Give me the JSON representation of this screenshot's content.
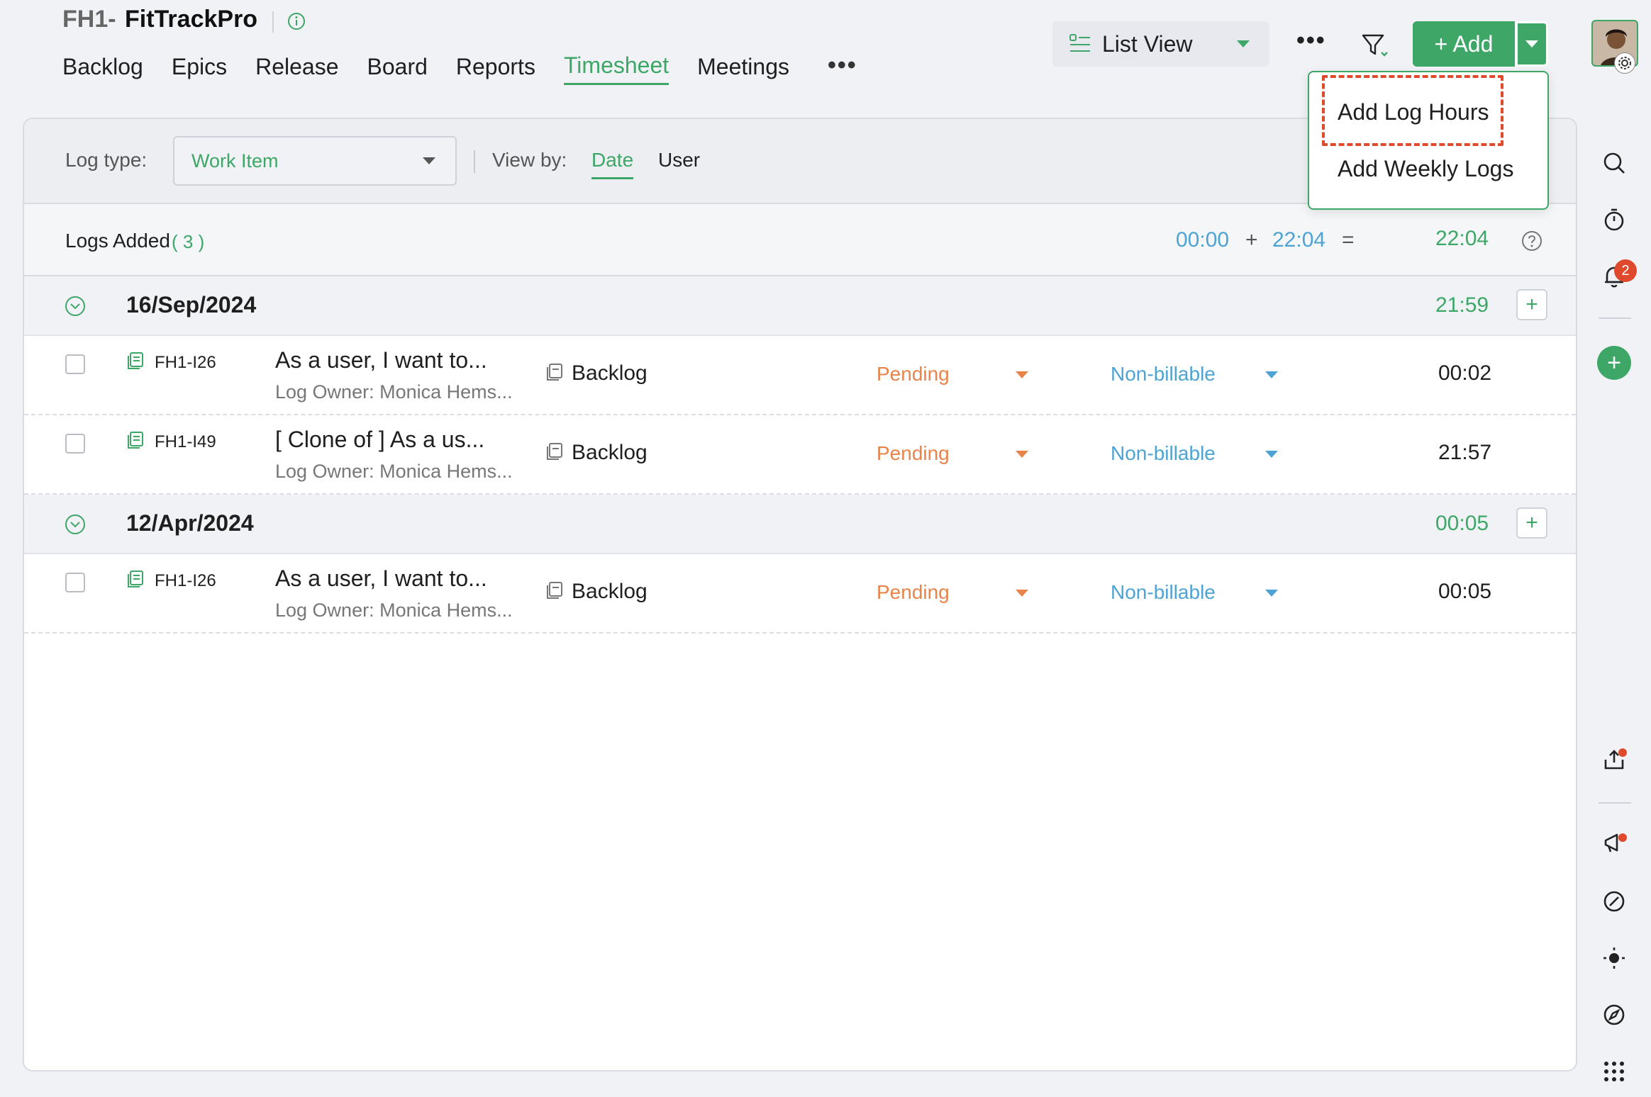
{
  "project": {
    "prefix": "FH1-",
    "name": "FitTrackPro"
  },
  "nav": {
    "items": [
      "Backlog",
      "Epics",
      "Release",
      "Board",
      "Reports",
      "Timesheet",
      "Meetings"
    ],
    "active": "Timesheet",
    "more": "•••"
  },
  "toolbar": {
    "view_label": "List View",
    "more": "•••",
    "add_label": "+ Add"
  },
  "add_menu": {
    "items": [
      "Add Log Hours",
      "Add Weekly Logs"
    ],
    "highlighted": "Add Log Hours"
  },
  "filters": {
    "log_type_label": "Log type:",
    "log_type_value": "Work Item",
    "view_by_label": "View by:",
    "view_by_options": [
      "Date",
      "User"
    ],
    "view_by_selected": "Date"
  },
  "summary": {
    "label": "Logs Added",
    "count": "( 3 )",
    "billable": "00:00",
    "plus": "+",
    "non_billable": "22:04",
    "equals": "=",
    "total": "22:04"
  },
  "groups": [
    {
      "date": "16/Sep/2024",
      "total": "21:59",
      "add": "+",
      "rows": [
        {
          "id": "FH1-I26",
          "title": "As a user, I want to...",
          "owner": "Log Owner: Monica Hems...",
          "type": "Backlog",
          "status": "Pending",
          "billing": "Non-billable",
          "hours": "00:02"
        },
        {
          "id": "FH1-I49",
          "title": "[ Clone of ] As a us...",
          "owner": "Log Owner: Monica Hems...",
          "type": "Backlog",
          "status": "Pending",
          "billing": "Non-billable",
          "hours": "21:57"
        }
      ]
    },
    {
      "date": "12/Apr/2024",
      "total": "00:05",
      "add": "+",
      "rows": [
        {
          "id": "FH1-I26",
          "title": "As a user, I want to...",
          "owner": "Log Owner: Monica Hems...",
          "type": "Backlog",
          "status": "Pending",
          "billing": "Non-billable",
          "hours": "00:05"
        }
      ]
    }
  ],
  "rail": {
    "notification_count": "2",
    "add": "+",
    "icons": [
      "search-icon",
      "timer-icon",
      "bell-icon",
      "add-icon",
      "share-icon",
      "announcement-icon",
      "link-icon",
      "theme-icon",
      "compass-icon",
      "apps-grid-icon"
    ]
  },
  "colors": {
    "accent": "#3ea768",
    "billing": "#4da3d4",
    "status": "#e8834a",
    "highlight": "#e04a2c"
  }
}
